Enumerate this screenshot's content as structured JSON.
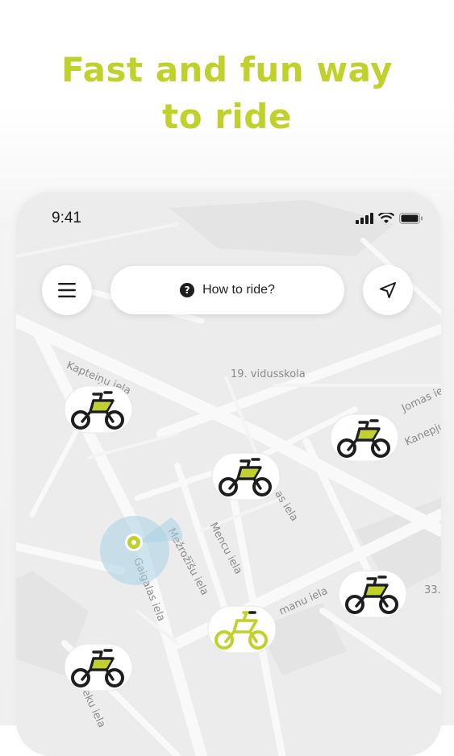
{
  "headline": {
    "line1": "Fast and fun way",
    "line2": "to ride"
  },
  "status_bar": {
    "time": "9:41",
    "icons": [
      "signal-icon",
      "wifi-icon",
      "battery-icon"
    ]
  },
  "controls": {
    "menu_icon": "menu-icon",
    "help_label": "How to ride?",
    "help_icon": "question-icon",
    "locate_icon": "navigation-arrow-icon"
  },
  "map": {
    "labels": {
      "kapteinu": "Kapteiņu iela",
      "school": "19. vidusskola",
      "jomas": "Jomas iela",
      "kanepju": "Kanepju",
      "as_iela": "as iela",
      "mencu": "Mencu iela",
      "mezrozisu": "Mežrožīšu iela",
      "gaigalas": "Gaigalas iela",
      "manu": "manu iela",
      "eku": "eku iela",
      "num33": "33."
    },
    "bike_icon": "bicycle-icon",
    "location_icon": "current-location-icon"
  },
  "colors": {
    "accent": "#bfd12a",
    "dark": "#1e1e1e"
  }
}
